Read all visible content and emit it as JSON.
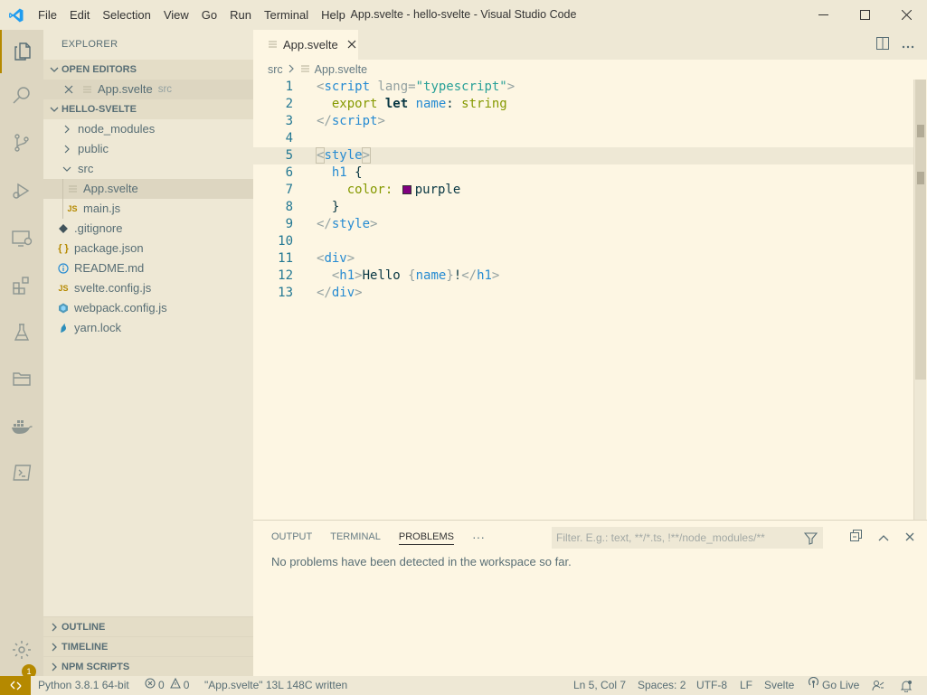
{
  "window": {
    "menu": [
      "File",
      "Edit",
      "Selection",
      "View",
      "Go",
      "Run",
      "Terminal",
      "Help"
    ],
    "title": "App.svelte - hello-svelte - Visual Studio Code"
  },
  "activity_bar": {
    "items": [
      "explorer-icon",
      "search-icon",
      "source-control-icon",
      "run-debug-icon",
      "remote-explorer-icon",
      "extensions-icon",
      "testing-icon",
      "folder-icon",
      "docker-icon",
      "terminal-icon"
    ],
    "settings_badge": "1"
  },
  "sidebar": {
    "title": "EXPLORER",
    "open_editors": {
      "heading": "OPEN EDITORS",
      "items": [
        {
          "name": "App.svelte",
          "desc": "src"
        }
      ]
    },
    "project": {
      "heading": "HELLO-SVELTE",
      "tree": [
        {
          "name": "node_modules",
          "type": "folder",
          "depth": 0
        },
        {
          "name": "public",
          "type": "folder",
          "depth": 0
        },
        {
          "name": "src",
          "type": "folder-open",
          "depth": 0
        },
        {
          "name": "App.svelte",
          "type": "file",
          "depth": 1,
          "selected": true
        },
        {
          "name": "main.js",
          "type": "js",
          "depth": 1
        },
        {
          "name": ".gitignore",
          "type": "git",
          "depth": 0
        },
        {
          "name": "package.json",
          "type": "json",
          "depth": 0
        },
        {
          "name": "README.md",
          "type": "info",
          "depth": 0
        },
        {
          "name": "svelte.config.js",
          "type": "js",
          "depth": 0
        },
        {
          "name": "webpack.config.js",
          "type": "webpack",
          "depth": 0
        },
        {
          "name": "yarn.lock",
          "type": "yarn",
          "depth": 0
        }
      ]
    },
    "bottom_sections": [
      "OUTLINE",
      "TIMELINE",
      "NPM SCRIPTS"
    ]
  },
  "editor": {
    "tab": "App.svelte",
    "breadcrumb": [
      "src",
      "App.svelte"
    ],
    "line_numbers": [
      "1",
      "2",
      "3",
      "4",
      "5",
      "6",
      "7",
      "8",
      "9",
      "10",
      "11",
      "12",
      "13"
    ],
    "cursor_line": "5",
    "code": {
      "l1": {
        "a": "<",
        "b": "script",
        "c": " lang=",
        "d": "\"typescript\"",
        "e": ">"
      },
      "l2": {
        "a": "  export ",
        "b": "let ",
        "c": "name",
        "d": ": ",
        "e": "string"
      },
      "l3": {
        "a": "</",
        "b": "script",
        "c": ">"
      },
      "l5": {
        "a": "<",
        "b": "style",
        "c": ">"
      },
      "l6": {
        "a": "  h1 ",
        "b": "{"
      },
      "l7": {
        "a": "    color: ",
        "b": "purple"
      },
      "l8": {
        "a": "  }"
      },
      "l9": {
        "a": "</",
        "b": "style",
        "c": ">"
      },
      "l11": {
        "a": "<",
        "b": "div",
        "c": ">"
      },
      "l12": {
        "a": "  <",
        "b": "h1",
        "c": ">",
        "d": "Hello ",
        "e": "{",
        "f": "name",
        "g": "}",
        "h": "!",
        "i": "</",
        "j": "h1",
        "k": ">"
      },
      "l13": {
        "a": "</",
        "b": "div",
        "c": ">"
      }
    },
    "swatch_color": "#800080"
  },
  "panel": {
    "tabs": [
      "OUTPUT",
      "TERMINAL",
      "PROBLEMS"
    ],
    "active_tab": "PROBLEMS",
    "more": "···",
    "filter_placeholder": "Filter. E.g.: text, **/*.ts, !**/node_modules/**",
    "message": "No problems have been detected in the workspace so far."
  },
  "status_bar": {
    "python": "Python 3.8.1 64-bit",
    "errors": "0",
    "warnings": "0",
    "written": "\"App.svelte\" 13L 148C written",
    "position": "Ln 5, Col 7",
    "spaces": "Spaces: 2",
    "encoding": "UTF-8",
    "eol": "LF",
    "language": "Svelte",
    "golive": "Go Live"
  },
  "colors": {
    "editor_bg": "#fdf6e3",
    "sidebar_bg": "#eee8d5",
    "activity_bg": "#ddd6c1",
    "accent": "#b58900",
    "tag": "#268bd2",
    "string": "#2aa198",
    "keyword": "#859900"
  }
}
